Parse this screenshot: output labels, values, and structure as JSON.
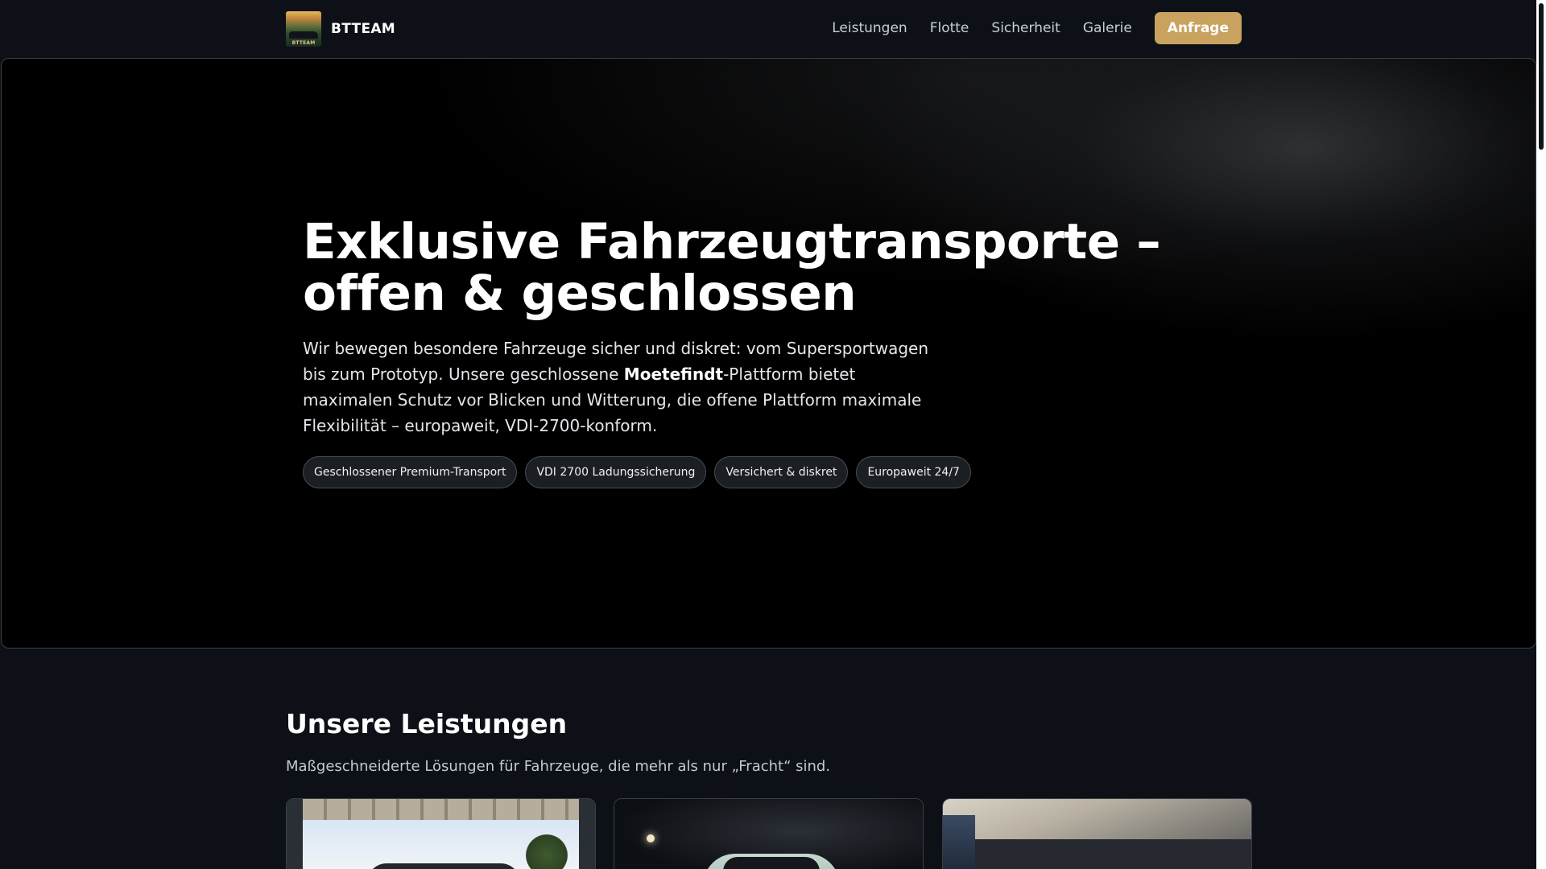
{
  "nav": {
    "brand_name": "BTTEAM",
    "logo_text": "BTTEAM",
    "links": [
      "Leistungen",
      "Flotte",
      "Sicherheit",
      "Galerie"
    ],
    "cta_label": "Anfrage"
  },
  "hero": {
    "title": "Exklusive Fahrzeugtransporte – offen & geschlossen",
    "lead_part1": "Wir bewegen besondere Fahrzeuge sicher und diskret: vom Supersportwagen bis zum Prototyp. Unsere geschlossene ",
    "lead_bold": "Moetefindt",
    "lead_part2": "-Plattform bietet maximalen Schutz vor Blicken und Witterung, die offene Plattform maximale Flexibilität – europaweit, VDI-2700-konform.",
    "chips": [
      "Geschlossener Premium-Transport",
      "VDI 2700 Ladungssicherung",
      "Versichert & diskret",
      "Europaweit 24/7"
    ]
  },
  "services": {
    "title": "Unsere Leistungen",
    "subtitle": "Maßgeschneiderte Lösungen für Fahrzeuge, die mehr als nur „Fracht“ sind."
  },
  "colors": {
    "background": "#0d1117",
    "accent": "#c8a25e",
    "hero_background": "#000000"
  }
}
